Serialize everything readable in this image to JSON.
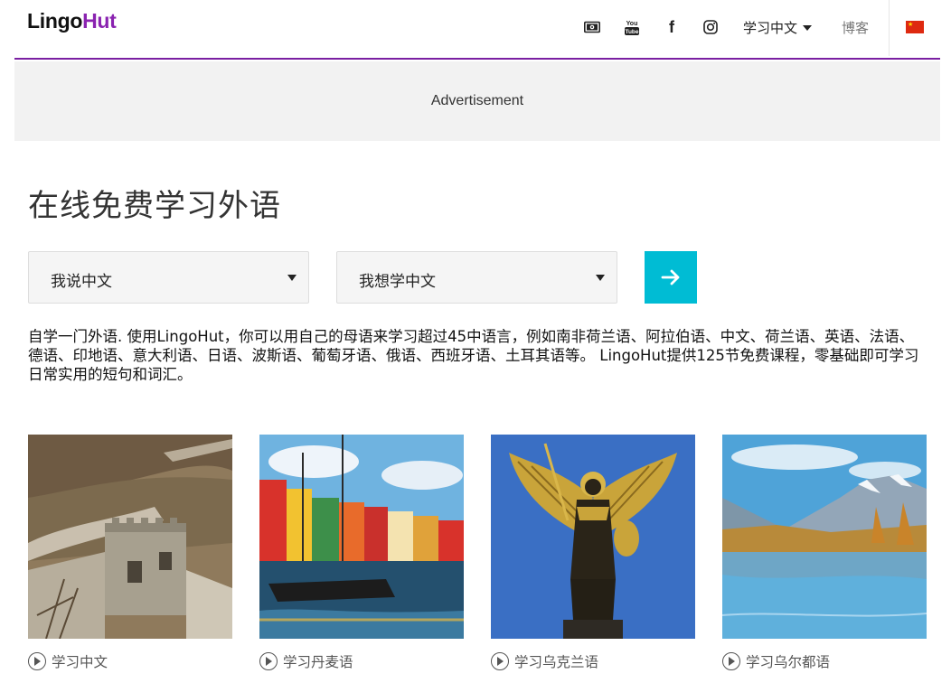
{
  "header": {
    "logo_part1": "Lingo",
    "logo_part2": "Hut",
    "icons": [
      "money-icon",
      "youtube-icon",
      "facebook-icon",
      "instagram-icon"
    ],
    "youtube_text_top": "You",
    "youtube_text_bottom": "Tube",
    "facebook_glyph": "f",
    "language_menu_label": "学习中文",
    "blog_label": "博客",
    "flag": "china-flag-icon"
  },
  "ad": {
    "label": "Advertisement"
  },
  "main": {
    "title": "在线免费学习外语",
    "speak_select": "我说中文",
    "learn_select": "我想学中文",
    "go_button": "arrow-right-icon",
    "description": "自学一门外语. 使用LingoHut，你可以用自己的母语来学习超过45中语言，例如南非荷兰语、阿拉伯语、中文、荷兰语、英语、法语、德语、印地语、意大利语、日语、波斯语、葡萄牙语、俄语、西班牙语、土耳其语等。 LingoHut提供125节免费课程，零基础即可学习日常实用的短句和词汇。"
  },
  "cards": [
    {
      "label": "学习中文"
    },
    {
      "label": "学习丹麦语"
    },
    {
      "label": "学习乌克兰语"
    },
    {
      "label": "学习乌尔都语"
    }
  ],
  "colors": {
    "brand_purple": "#8a23b0",
    "accent_cyan": "#00bcd4",
    "header_rule": "#7a1fa2"
  }
}
